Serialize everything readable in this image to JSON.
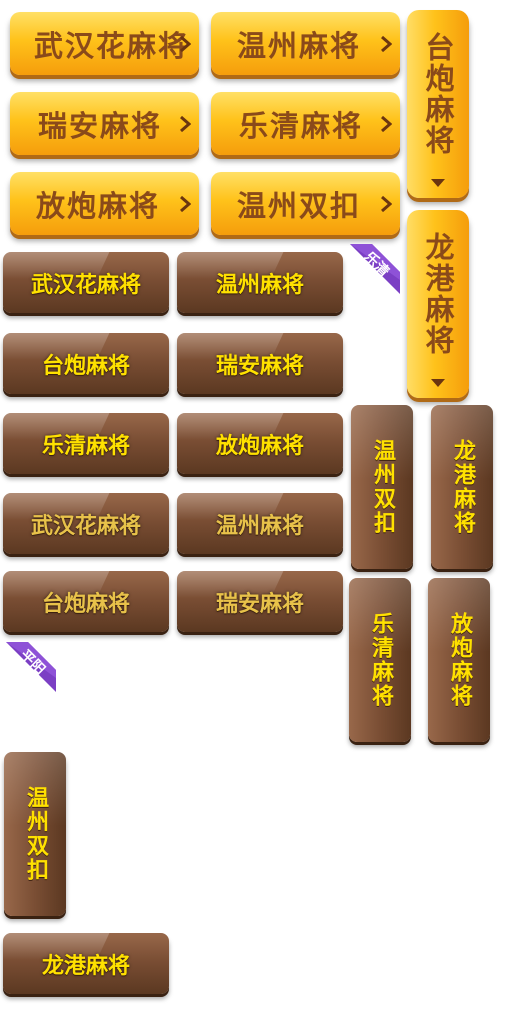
{
  "colors": {
    "gold_text": "#8a4a1a",
    "brown_text": "#ffe100",
    "ribbon": "#7b3fc4"
  },
  "gold_buttons": [
    "武汉花麻将",
    "温州麻将",
    "瑞安麻将",
    "乐清麻将",
    "放炮麻将",
    "温州双扣"
  ],
  "gold_vertical": [
    "台炮麻将",
    "龙港麻将"
  ],
  "brown_buttons": [
    "武汉花麻将",
    "温州麻将",
    "台炮麻将",
    "瑞安麻将",
    "乐清麻将",
    "放炮麻将",
    "武汉花麻将",
    "温州麻将",
    "台炮麻将",
    "瑞安麻将"
  ],
  "brown_vertical": [
    "温州双扣",
    "龙港麻将",
    "乐清麻将",
    "放炮麻将",
    "温州双扣"
  ],
  "brown_bottom": "龙港麻将",
  "ribbons": [
    "乐清",
    "平阳"
  ],
  "icons": {
    "arrow": "chevron-right-icon",
    "down": "chevron-down-icon"
  }
}
